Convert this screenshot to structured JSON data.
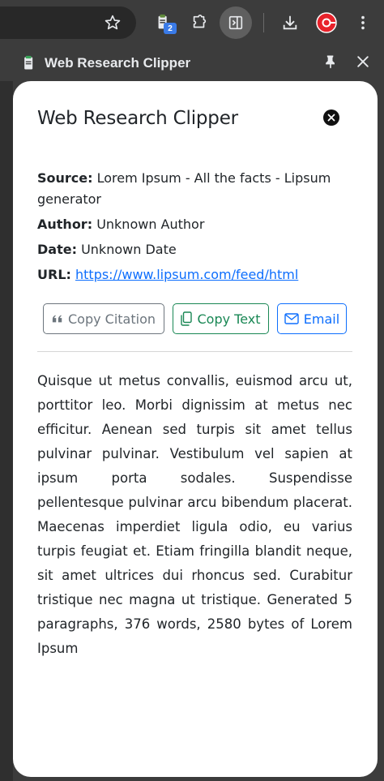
{
  "browser": {
    "extension_badge": "2"
  },
  "panel": {
    "title": "Web Research Clipper"
  },
  "popup": {
    "title": "Web Research Clipper",
    "meta": {
      "source_label": "Source:",
      "source_value": "Lorem Ipsum - All the facts - Lipsum generator",
      "author_label": "Author:",
      "author_value": "Unknown Author",
      "date_label": "Date:",
      "date_value": "Unknown Date",
      "url_label": "URL:",
      "url_value": "https://www.lipsum.com/feed/html"
    },
    "buttons": {
      "copy_citation": "Copy Citation",
      "copy_text": "Copy Text",
      "email": "Email"
    },
    "content": "Quisque ut metus convallis, euismod arcu ut, porttitor leo. Morbi dignissim at metus nec efficitur. Aenean sed turpis sit amet tellus pulvinar pulvinar. Vestibulum vel sapien at ipsum porta sodales. Suspendisse pellentesque pulvinar arcu bibendum placerat. Maecenas imperdiet ligula odio, eu varius turpis feugiat et. Etiam fringilla blandit neque, sit amet ultrices dui rhoncus sed. Curabitur tristique nec magna ut tristique. Generated 5 paragraphs, 376 words, 2580 bytes of Lorem Ipsum"
  },
  "colors": {
    "secondary": "#6c757d",
    "success": "#198754",
    "primary": "#0d6efd",
    "chrome_bg": "#3c3c3c",
    "profile_red": "#e8222b"
  },
  "icons": [
    "star-icon",
    "clipboard-extension-icon",
    "puzzle-icon",
    "side-panel-icon",
    "download-icon",
    "profile-avatar-icon",
    "more-vert-icon",
    "pin-icon",
    "close-icon",
    "quote-icon",
    "copy-icon",
    "envelope-icon"
  ]
}
